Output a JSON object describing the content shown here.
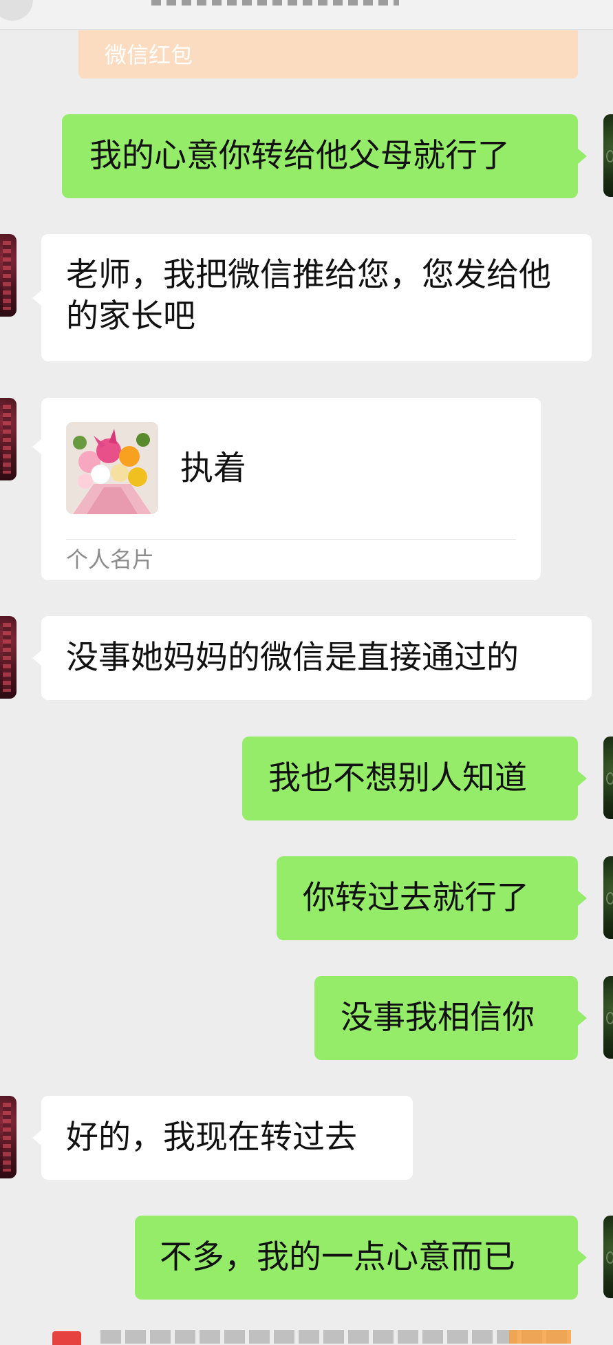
{
  "top_cards": {
    "redpacket_label": "微信红包"
  },
  "messages": [
    {
      "side": "out",
      "text": "我的心意你转给他父母就行了"
    },
    {
      "side": "in",
      "text": "老师，我把微信推给您，您发给他的家长吧"
    },
    {
      "side": "in",
      "type": "contact-card",
      "name": "执着",
      "card_type": "个人名片"
    },
    {
      "side": "in",
      "text": "没事她妈妈的微信是直接通过的"
    },
    {
      "side": "out",
      "text": "我也不想别人知道"
    },
    {
      "side": "out",
      "text": "你转过去就行了"
    },
    {
      "side": "out",
      "text": "没事我相信你"
    },
    {
      "side": "in",
      "text": "好的，我现在转过去"
    },
    {
      "side": "out",
      "text": "不多，我的一点心意而已"
    }
  ],
  "colors": {
    "background": "#ededed",
    "outgoing_bubble": "#95ec69",
    "incoming_bubble": "#ffffff",
    "redpacket_card": "#fcdcc0",
    "redpacket_icon": "#e64340"
  }
}
